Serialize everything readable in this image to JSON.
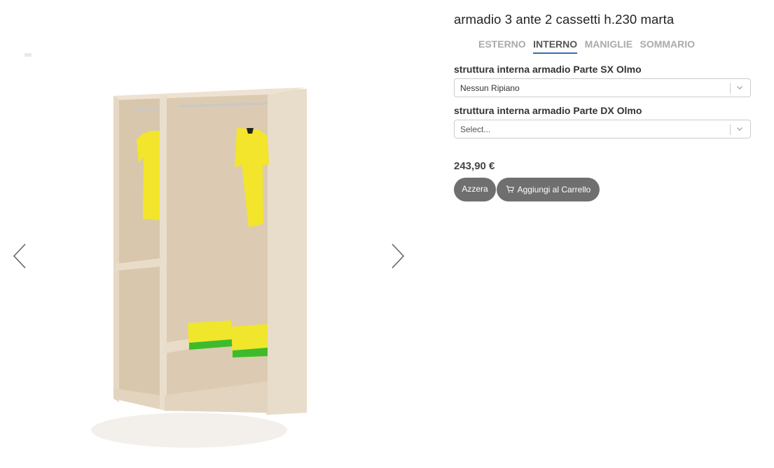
{
  "product": {
    "title": "armadio 3 ante 2 cassetti h.230 marta"
  },
  "tabs": [
    {
      "label": "ESTERNO",
      "active": false
    },
    {
      "label": "INTERNO",
      "active": true
    },
    {
      "label": "MANIGLIE",
      "active": false
    },
    {
      "label": "SOMMARIO",
      "active": false
    }
  ],
  "options": {
    "left": {
      "label": "struttura interna armadio Parte SX Olmo",
      "value": "Nessun Ripiano"
    },
    "right": {
      "label": "struttura interna armadio Parte DX Olmo",
      "placeholder": "Select..."
    }
  },
  "price": "243,90 €",
  "buttons": {
    "reset": "Azzera",
    "add_to_cart": "Aggiungi al Carrello"
  },
  "icons": {
    "prev": "chevron-left-icon",
    "next": "chevron-right-icon",
    "dropdown": "chevron-down-icon",
    "cart": "cart-icon"
  },
  "colors": {
    "active_tab_underline": "#2f6fb5",
    "button_bg": "#6f6f6f",
    "wood": "#e2d3bf",
    "shirt": "#f2e52b",
    "folded_green": "#3dbb2c"
  }
}
